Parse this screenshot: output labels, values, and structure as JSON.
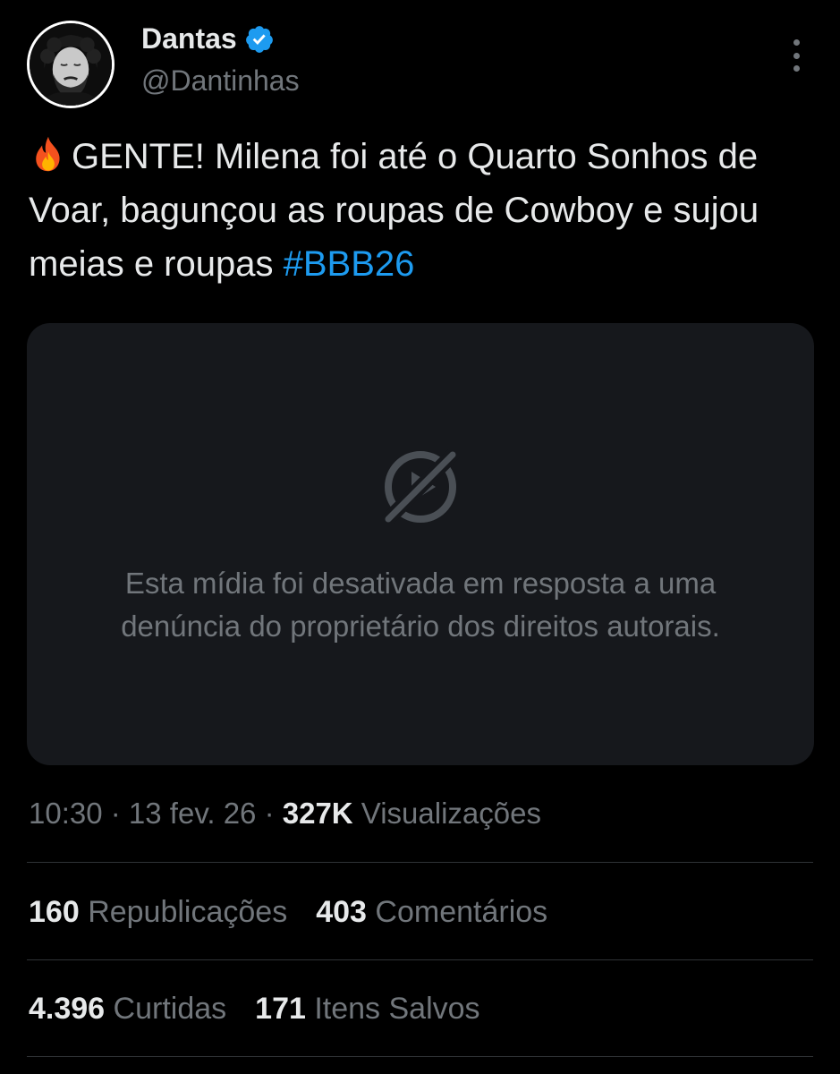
{
  "author": {
    "name": "Dantas",
    "handle": "@Dantinhas",
    "verified_color": "#1d9bf0"
  },
  "tweet": {
    "emoji_icon": "fire-icon",
    "text": "GENTE! Milena foi até o Quarto Sonhos de Voar, bagunçou as roupas de Cowboy e sujou meias e roupas ",
    "hashtag": "#BBB26"
  },
  "media": {
    "icon": "media-disabled-icon",
    "line1": "Esta mídia foi desativada em resposta a uma",
    "line2": "denúncia do proprietário dos direitos autorais."
  },
  "meta": {
    "time": "10:30",
    "sep1": " · ",
    "date": "13 fev. 26",
    "sep2": " · ",
    "views_count": "327K",
    "views_label": " Visualizações"
  },
  "stats": {
    "reposts_count": "160",
    "reposts_label": "Republicações",
    "comments_count": "403",
    "comments_label": "Comentários",
    "likes_count": "4.396",
    "likes_label": "Curtidas",
    "saved_count": "171",
    "saved_label": "Itens Salvos"
  },
  "colors": {
    "background": "#000000",
    "text": "#e7e9ea",
    "muted": "#71767b",
    "accent": "#1d9bf0",
    "card": "#16181c"
  }
}
